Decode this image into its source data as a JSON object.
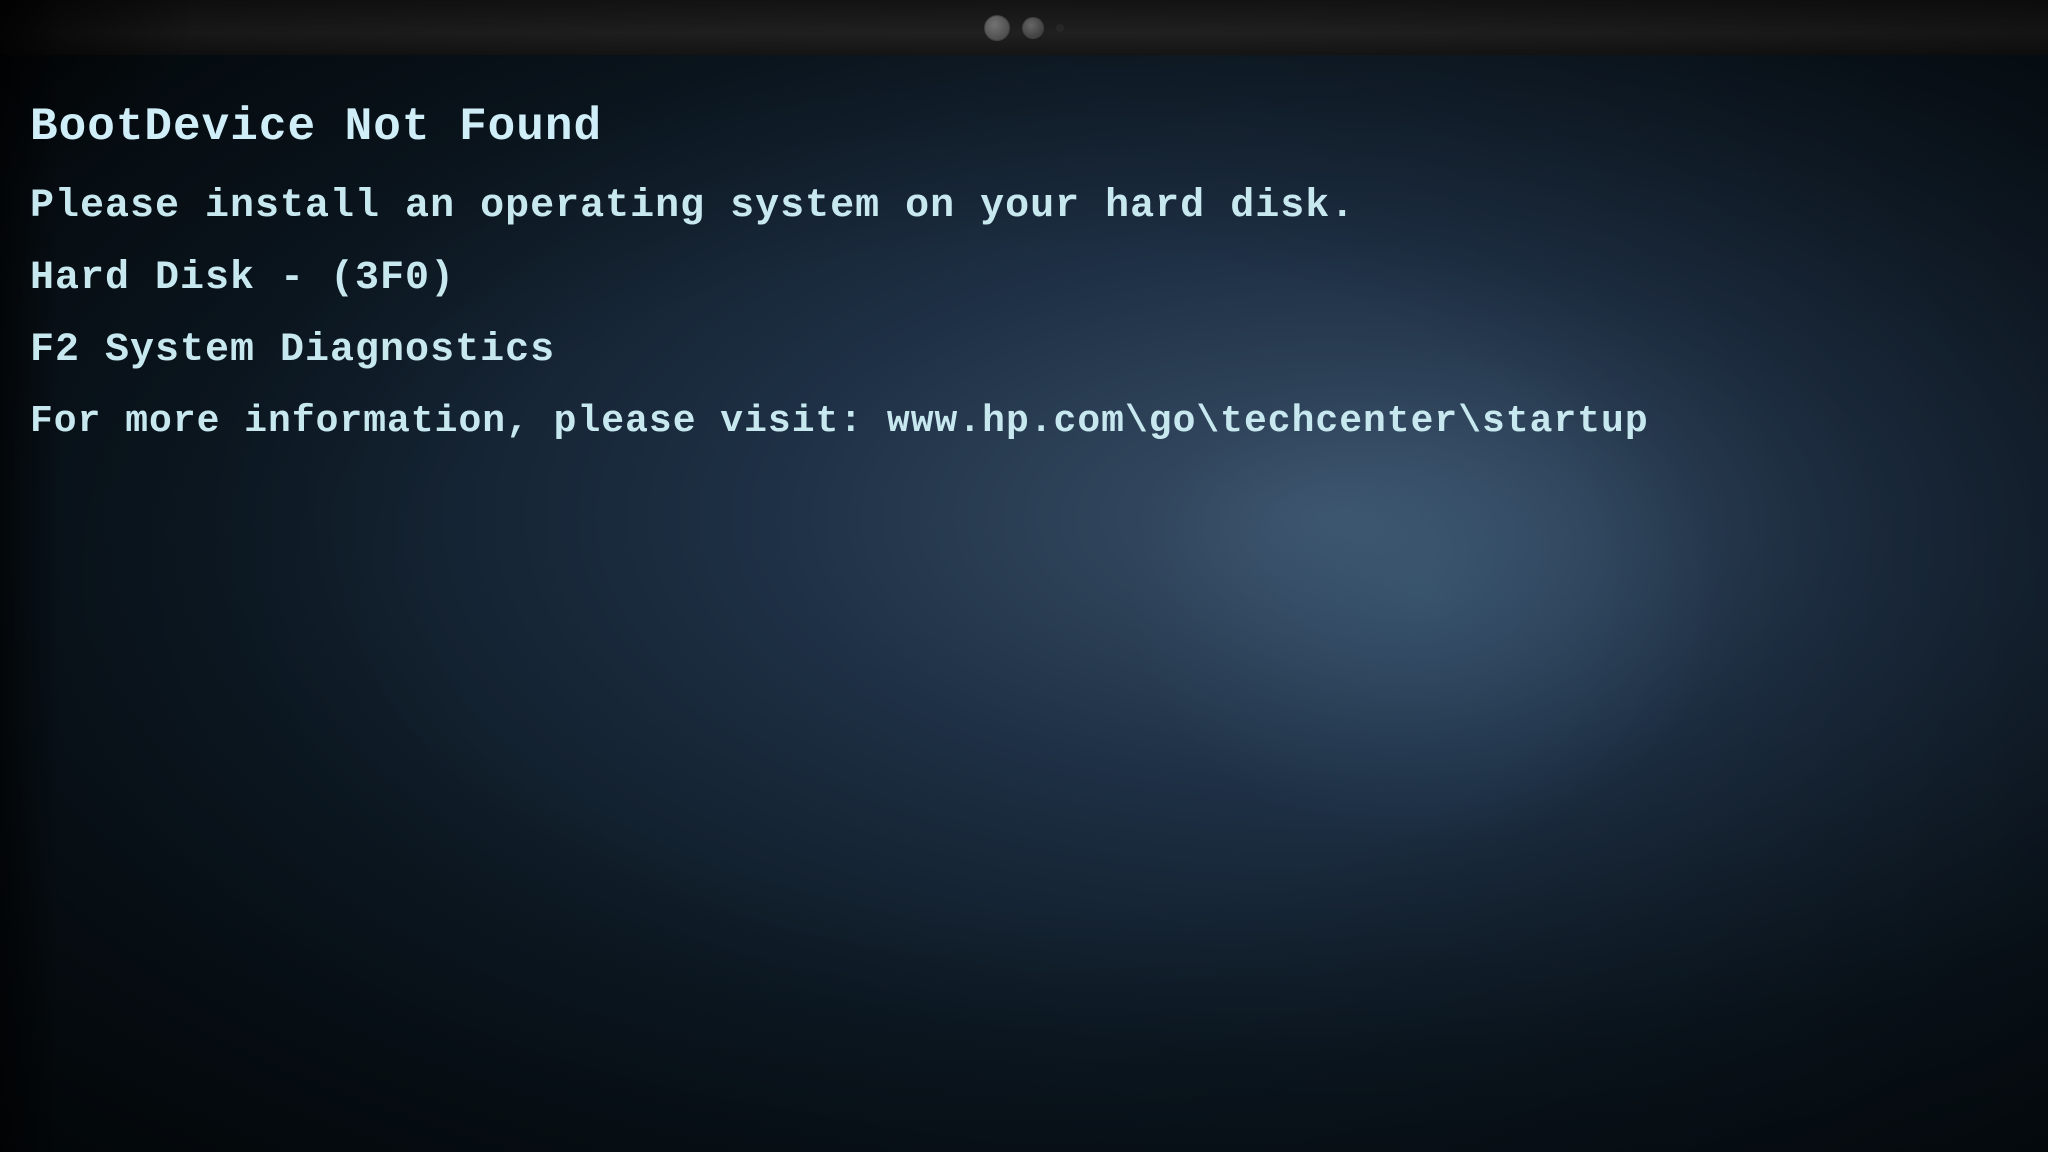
{
  "bezel": {
    "label": "top bezel"
  },
  "screen": {
    "title": "BootDevice Not Found",
    "line2": "Please install an operating system on your hard disk.",
    "line3": "Hard Disk - (3F0)",
    "line4": "F2 System Diagnostics",
    "line5": "For more information, please visit:  www.hp.com\\go\\techcenter\\startup"
  },
  "colors": {
    "text": "#c8e8f0",
    "background_dark": "#0d1a25",
    "background_mid": "#1e3045"
  }
}
